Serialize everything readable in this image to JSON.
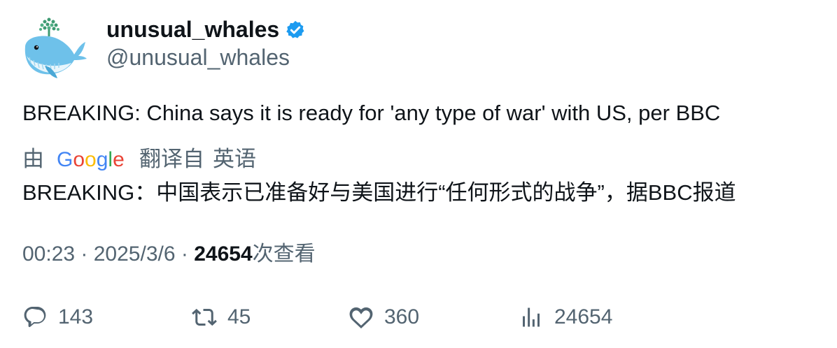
{
  "author": {
    "display_name": "unusual_whales",
    "handle": "@unusual_whales"
  },
  "tweet": {
    "text": "BREAKING: China says it is ready for 'any type of war' with US, per BBC"
  },
  "translation": {
    "by_label": "由",
    "provider": "Google",
    "translated_from": "翻译自",
    "language": "英语",
    "text": "BREAKING：中国表示已准备好与美国进行“任何形式的战争”，据BBC报道"
  },
  "meta": {
    "time": "00:23",
    "separator": " · ",
    "date": "2025/3/6",
    "views_count": "24654",
    "views_label": "次查看"
  },
  "actions": {
    "replies": "143",
    "retweets": "45",
    "likes": "360",
    "views": "24654"
  },
  "colors": {
    "text_primary": "#0f1419",
    "text_secondary": "#536471",
    "verified_blue": "#1d9bf0",
    "whale_blue": "#6ec1ea",
    "spout_green": "#3e9a72"
  },
  "icons": {
    "verified": "verified-badge-icon",
    "reply": "reply-icon",
    "retweet": "retweet-icon",
    "like": "heart-icon",
    "views": "views-bar-chart-icon"
  }
}
